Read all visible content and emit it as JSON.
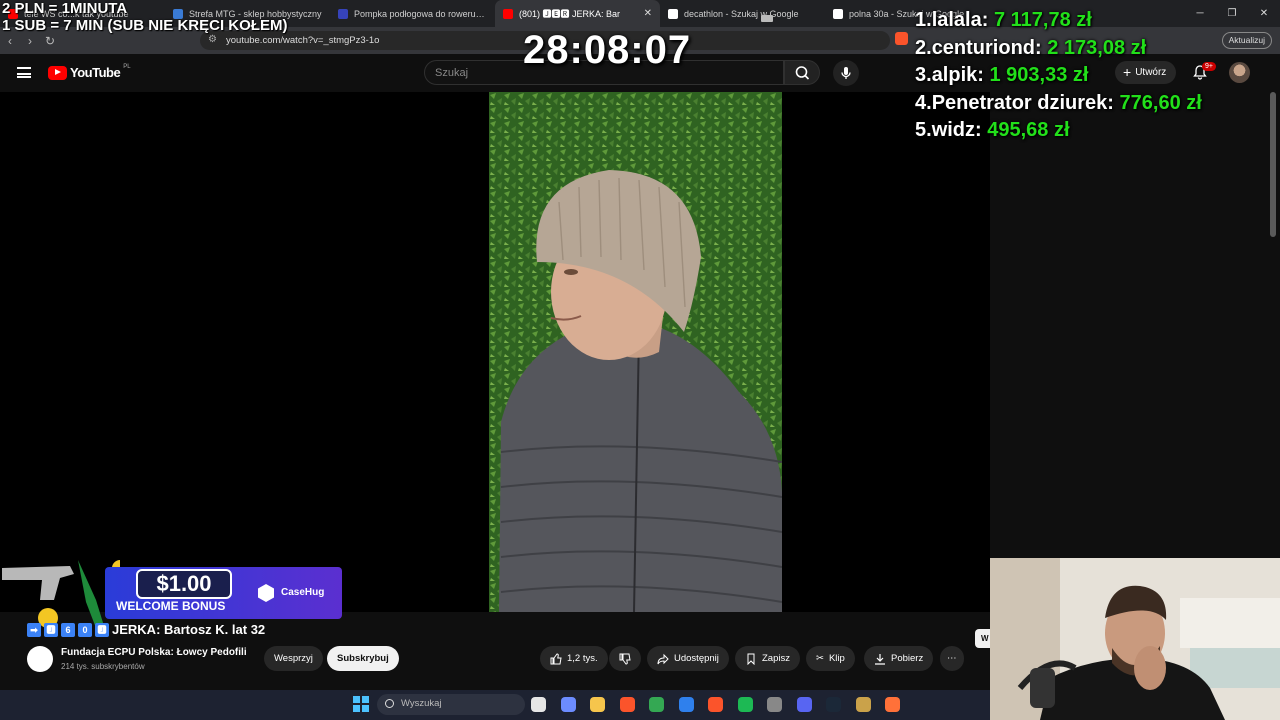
{
  "browser": {
    "tabs": [
      {
        "label": "tele WS co...k tak youtube",
        "fav_color": "#ff0000"
      },
      {
        "label": "Strefa MTG - sklep hobbystyczny",
        "fav_color": "#3a7bd5"
      },
      {
        "label": "Pompka podłogowa do roweru Btwin",
        "fav_color": "#3643ba"
      },
      {
        "label": "(801) 🅹🅴🆁 JERKA: Bar",
        "fav_color": "#ff0000",
        "active": true
      },
      {
        "label": "decathlon - Szukaj w Google",
        "fav_color": "#ffffff"
      },
      {
        "label": "polna 30a - Szukaj w Google",
        "fav_color": "#ffffff"
      }
    ],
    "url": "youtube.com/watch?v=_stmgPz3-1o",
    "update_label": "Aktualizuj"
  },
  "youtube": {
    "logo_word": "YouTube",
    "region": "PL",
    "search_placeholder": "Szukaj",
    "create_label": "Utwórz",
    "notif_badge": "9+"
  },
  "video": {
    "title_emojis": [
      "➡",
      "🅹",
      "6",
      "0",
      "🅹"
    ],
    "title": "JERKA: Bartosz K. lat 32",
    "channel_name": "Fundacja ECPU Polska: Łowcy Pedofili",
    "channel_subs": "214 tys. subskrybentów",
    "support_label": "Wesprzyj",
    "subscribe_label": "Subskrybuj",
    "likes": "1,2 tys.",
    "share_label": "Udostępnij",
    "save_label": "Zapisz",
    "clip_label": "Klip",
    "download_label": "Pobierz",
    "more_label": "⋯"
  },
  "overlay": {
    "line1": "2 PLN = 1MINUTA",
    "line2": "1 SUB = 7 MIN (SUB NIE KRĘCI KOŁEM)",
    "timer": "28:08:07",
    "leaderboard": [
      {
        "rank": "1.",
        "name": "lalala:",
        "amount": "7 117,78 zł"
      },
      {
        "rank": "2.",
        "name": "centuriond:",
        "amount": "2 173,08 zł"
      },
      {
        "rank": "3.",
        "name": "alpik:",
        "amount": "1 903,33 zł"
      },
      {
        "rank": "4.",
        "name": "Penetrator dziurek:",
        "amount": "776,60 zł"
      },
      {
        "rank": "5.",
        "name": "widz:",
        "amount": "495,68 zł"
      }
    ],
    "bonus_amount": "$1.00",
    "bonus_text": "WELCOME BONUS",
    "casehug": "CaseHug"
  },
  "taskbar": {
    "search_placeholder": "Wyszukaj",
    "icons": [
      {
        "name": "task-view-icon",
        "color": "#e6e6e6"
      },
      {
        "name": "copilot-icon",
        "color": "#6c8cff"
      },
      {
        "name": "file-explorer-icon",
        "color": "#f6c54c"
      },
      {
        "name": "brave-icon",
        "color": "#fb542b"
      },
      {
        "name": "chrome-icon",
        "color": "#34a853"
      },
      {
        "name": "store-icon",
        "color": "#2f80ed"
      },
      {
        "name": "brave-active-icon",
        "color": "#fb542b"
      },
      {
        "name": "spotify-icon",
        "color": "#1db954"
      },
      {
        "name": "app-icon",
        "color": "#888888"
      },
      {
        "name": "discord-icon",
        "color": "#5865f2"
      },
      {
        "name": "steam-icon",
        "color": "#1b2838"
      },
      {
        "name": "app2-icon",
        "color": "#caa24a"
      },
      {
        "name": "firefox-icon",
        "color": "#ff7139"
      }
    ]
  },
  "side_button_label": "W"
}
